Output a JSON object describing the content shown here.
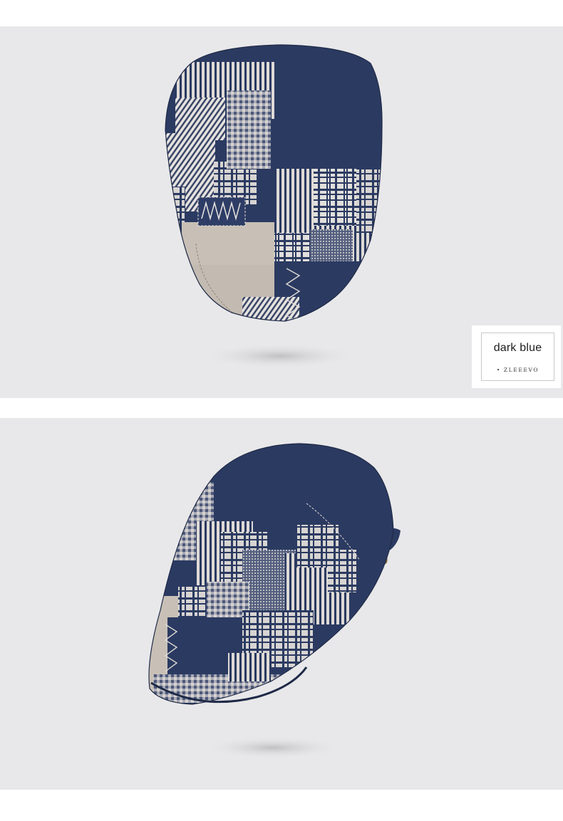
{
  "color_tag": {
    "name": "dark blue",
    "brand": "ZLEEEVO"
  },
  "photos": [
    {
      "view": "front",
      "icon": "patchwork-flat-cap"
    },
    {
      "view": "side",
      "icon": "patchwork-flat-cap"
    }
  ],
  "colors": {
    "navy": "#2b3a61",
    "beige": "#c8c0b6",
    "background": "#e8e8ea"
  }
}
